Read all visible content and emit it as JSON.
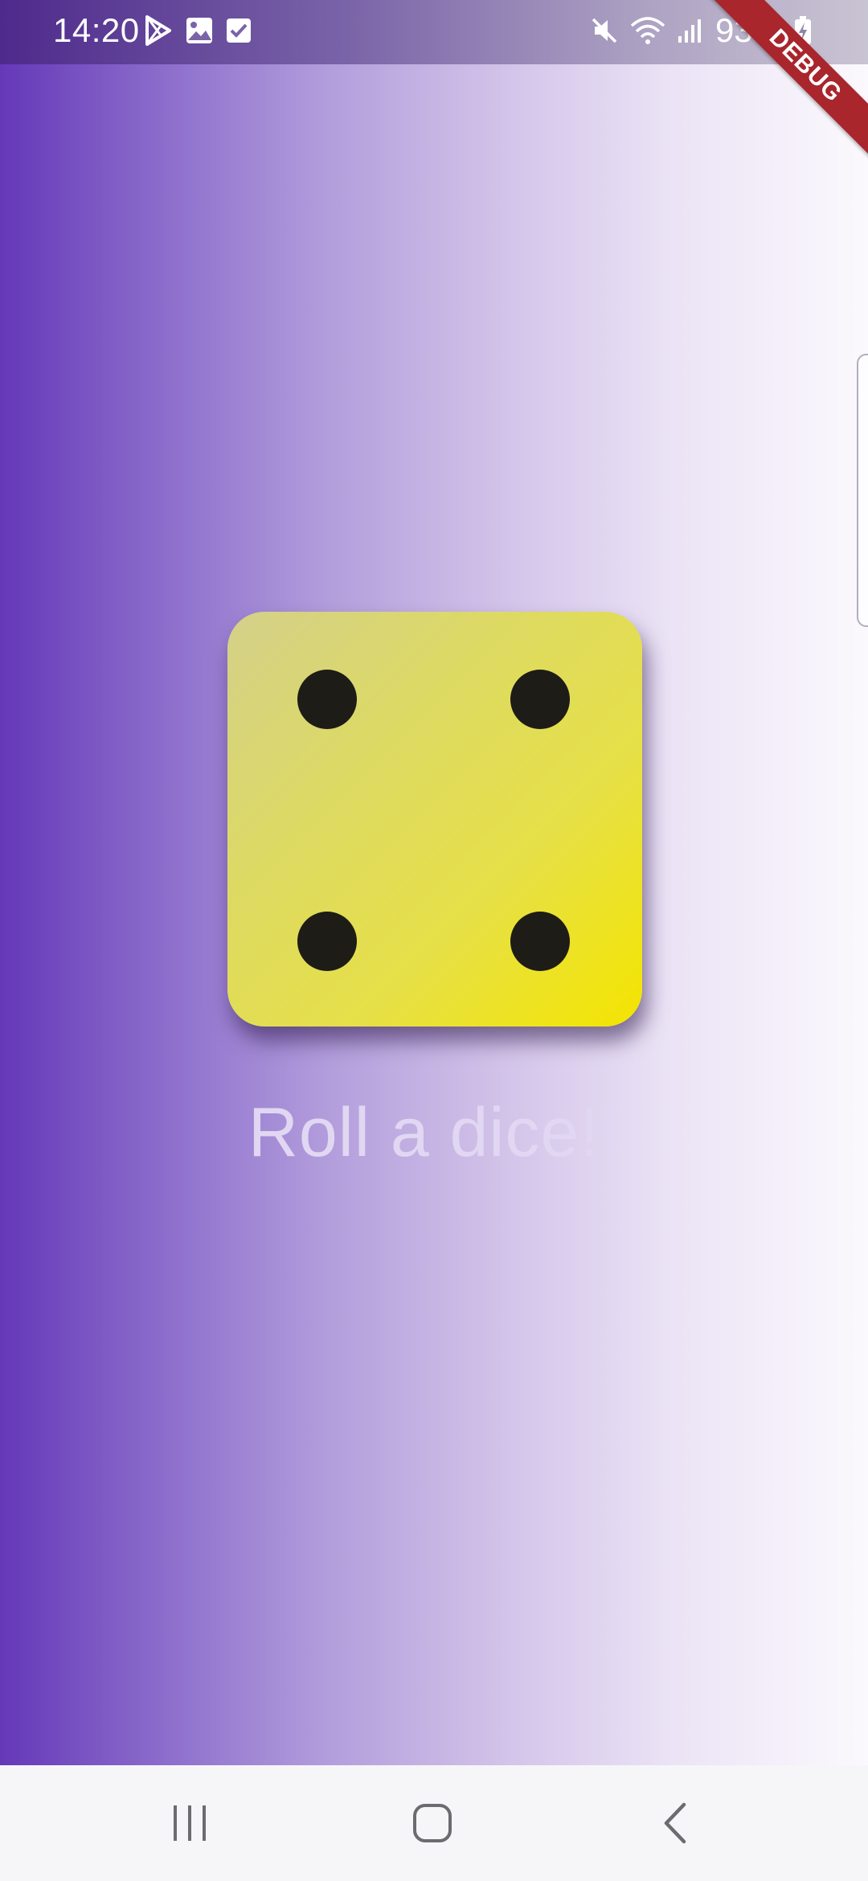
{
  "status_bar": {
    "time": "14:20",
    "left_icons": [
      "play-store-icon",
      "image-icon",
      "checkbox-icon"
    ],
    "right_icons": [
      "mute-icon",
      "wifi-icon",
      "signal-icon",
      "battery-icon"
    ],
    "battery_percent": "93%"
  },
  "debug_banner": {
    "label": "DEBUG"
  },
  "dice": {
    "face_value": 4,
    "pips": [
      "top-left",
      "top-right",
      "bottom-left",
      "bottom-right"
    ]
  },
  "main": {
    "prompt": "Roll a dice!!"
  },
  "nav_bar": {
    "buttons": [
      "recents-icon",
      "home-icon",
      "back-icon"
    ]
  },
  "colors": {
    "background_start": "#6538b8",
    "background_end": "#fbf9fd",
    "dice_face": "#e6e048",
    "pip": "#1e1c17",
    "prompt_text": "#e1d7f2",
    "debug_ribbon": "#a8262c"
  }
}
